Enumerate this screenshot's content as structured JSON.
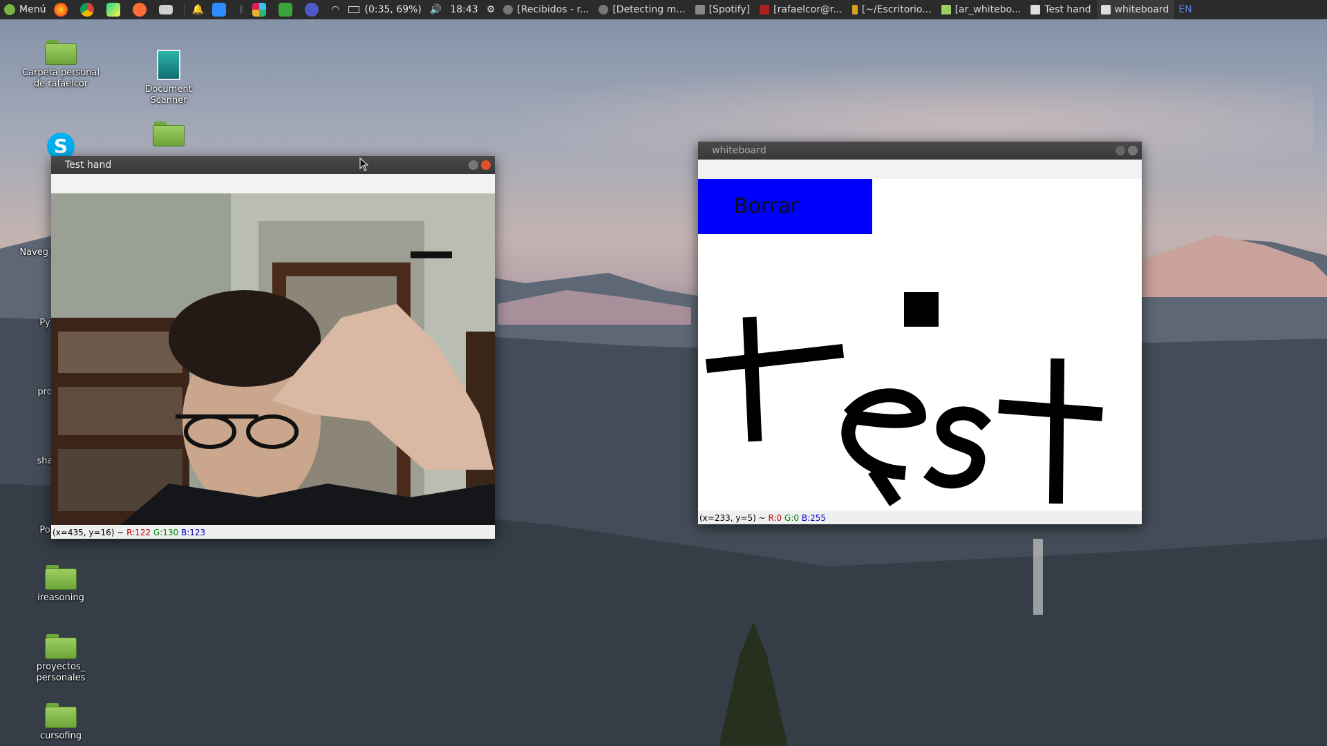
{
  "panel": {
    "menu_label": "Menú",
    "battery": "(0:35, 69%)",
    "clock": "18:43",
    "keyboard": "EN",
    "tasks": [
      {
        "label": "[Recibidos - r..."
      },
      {
        "label": "[Detecting m..."
      },
      {
        "label": "[Spotify]"
      },
      {
        "label": "[rafaelcor@r..."
      },
      {
        "label": "[~/Escritorio..."
      },
      {
        "label": "[ar_whitebo..."
      },
      {
        "label": "Test hand"
      },
      {
        "label": "whiteboard"
      }
    ]
  },
  "desktop": {
    "icons": [
      {
        "label": "Carpeta personal de rafaelcor"
      },
      {
        "label": "Document Scanner"
      },
      {
        "label": "ireasoning"
      },
      {
        "label": "proyectos_ personales"
      },
      {
        "label": "cursofing"
      }
    ],
    "partial_labels": [
      "S",
      "Naveg F",
      "Py",
      "pro",
      "sha",
      "Po"
    ]
  },
  "test_hand_window": {
    "title": "Test hand",
    "status": {
      "coords": "(x=435, y=16) ~ ",
      "r": "R:122",
      "g": "G:130",
      "b": "B:123"
    }
  },
  "whiteboard_window": {
    "title": "whiteboard",
    "button": "Borrar",
    "button_color": "#0000ff",
    "drawing_text": "Test",
    "status": {
      "coords": "(x=233, y=5) ~ ",
      "r": "R:0",
      "g": "G:0",
      "b": "B:255"
    }
  }
}
